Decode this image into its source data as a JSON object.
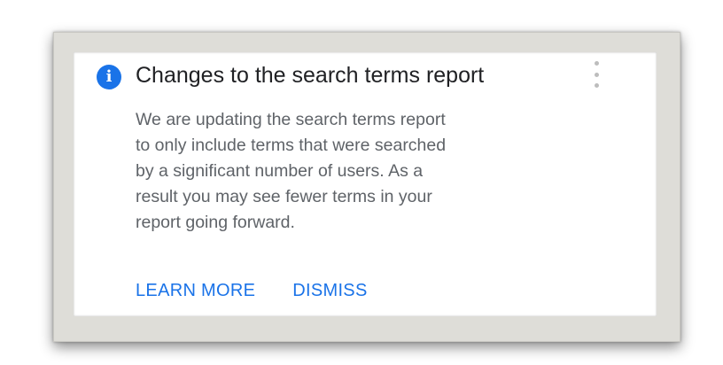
{
  "notification": {
    "icon": "info-icon",
    "title": "Changes to the search terms report",
    "body_lines": [
      "We are updating the search terms report",
      "to only include terms that were searched",
      "by a significant number of users. As a",
      "result you may see fewer terms in your",
      "report going forward."
    ],
    "menu_icon": "more-vert-icon",
    "actions": {
      "learn_more": "LEARN MORE",
      "dismiss": "DISMISS"
    }
  },
  "colors": {
    "accent": "#1a73e8",
    "title": "#202124",
    "body": "#5f6368",
    "frame": "#deddd8"
  }
}
